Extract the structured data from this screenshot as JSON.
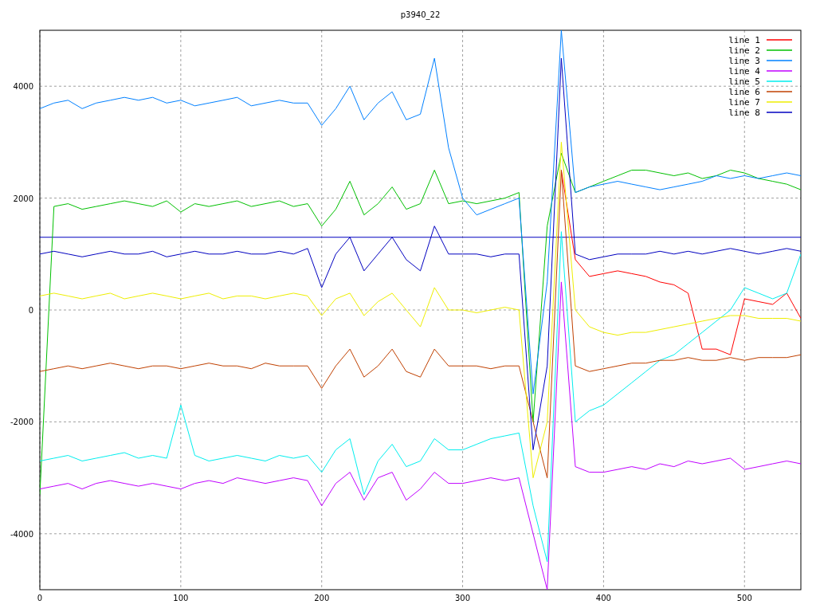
{
  "chart": {
    "chart_data": {
      "type": "line",
      "title": "p3940_22",
      "x": [
        0,
        10,
        20,
        30,
        40,
        50,
        60,
        70,
        80,
        90,
        100,
        110,
        120,
        130,
        140,
        150,
        160,
        170,
        180,
        190,
        200,
        210,
        220,
        230,
        240,
        250,
        260,
        270,
        280,
        290,
        300,
        310,
        320,
        330,
        340,
        350,
        360,
        370,
        380,
        390,
        400,
        410,
        420,
        430,
        440,
        450,
        460,
        470,
        480,
        490,
        500,
        510,
        520,
        530,
        540
      ],
      "xlim": [
        0,
        540
      ],
      "ylim": [
        -5000,
        5000
      ],
      "xticks": [
        0,
        100,
        200,
        300,
        400,
        500
      ],
      "yticks": [
        -4000,
        -2000,
        0,
        2000,
        4000
      ],
      "series": [
        {
          "name": "line 1",
          "color": "#ff0000",
          "values": [
            null,
            null,
            null,
            null,
            null,
            null,
            null,
            null,
            null,
            null,
            null,
            null,
            null,
            null,
            null,
            null,
            null,
            null,
            null,
            null,
            null,
            null,
            null,
            null,
            null,
            null,
            null,
            null,
            null,
            null,
            null,
            null,
            null,
            null,
            null,
            null,
            null,
            2500,
            900,
            600,
            650,
            700,
            650,
            600,
            500,
            450,
            300,
            -700,
            -700,
            -800,
            200,
            150,
            100,
            300,
            -150
          ]
        },
        {
          "name": "line 2",
          "color": "#00c000",
          "values": [
            -3300,
            1850,
            1900,
            1800,
            1850,
            1900,
            1950,
            1900,
            1850,
            1950,
            1750,
            1900,
            1850,
            1900,
            1950,
            1850,
            1900,
            1950,
            1850,
            1900,
            1500,
            1800,
            2300,
            1700,
            1900,
            2200,
            1800,
            1900,
            2500,
            1900,
            1950,
            1900,
            1950,
            2000,
            2100,
            -2000,
            1500,
            2800,
            2100,
            2200,
            2300,
            2400,
            2500,
            2500,
            2450,
            2400,
            2450,
            2350,
            2400,
            2500,
            2450,
            2350,
            2300,
            2250,
            2150
          ]
        },
        {
          "name": "line 3",
          "color": "#0080ff",
          "values": [
            3600,
            3700,
            3750,
            3600,
            3700,
            3750,
            3800,
            3750,
            3800,
            3700,
            3750,
            3650,
            3700,
            3750,
            3800,
            3650,
            3700,
            3750,
            3700,
            3700,
            3300,
            3600,
            4000,
            3400,
            3700,
            3900,
            3400,
            3500,
            4500,
            2900,
            2000,
            1700,
            1800,
            1900,
            2000,
            -1500,
            500,
            5000,
            2100,
            2200,
            2250,
            2300,
            2250,
            2200,
            2150,
            2200,
            2250,
            2300,
            2400,
            2350,
            2400,
            2350,
            2400,
            2450,
            2400
          ]
        },
        {
          "name": "line 4",
          "color": "#c000ff",
          "values": [
            -3200,
            -3150,
            -3100,
            -3200,
            -3100,
            -3050,
            -3100,
            -3150,
            -3100,
            -3150,
            -3200,
            -3100,
            -3050,
            -3100,
            -3000,
            -3050,
            -3100,
            -3050,
            -3000,
            -3050,
            -3500,
            -3100,
            -2900,
            -3400,
            -3000,
            -2900,
            -3400,
            -3200,
            -2900,
            -3100,
            -3100,
            -3050,
            -3000,
            -3050,
            -3000,
            -4000,
            -5000,
            500,
            -2800,
            -2900,
            -2900,
            -2850,
            -2800,
            -2850,
            -2750,
            -2800,
            -2700,
            -2750,
            -2700,
            -2650,
            -2850,
            -2800,
            -2750,
            -2700,
            -2750
          ]
        },
        {
          "name": "line 5",
          "color": "#00eeee",
          "values": [
            -2700,
            -2650,
            -2600,
            -2700,
            -2650,
            -2600,
            -2550,
            -2650,
            -2600,
            -2650,
            -1700,
            -2600,
            -2700,
            -2650,
            -2600,
            -2650,
            -2700,
            -2600,
            -2650,
            -2600,
            -2900,
            -2500,
            -2300,
            -3300,
            -2700,
            -2400,
            -2800,
            -2700,
            -2300,
            -2500,
            -2500,
            -2400,
            -2300,
            -2250,
            -2200,
            -3500,
            -4500,
            1400,
            -2000,
            -1800,
            -1700,
            -1500,
            -1300,
            -1100,
            -900,
            -800,
            -600,
            -400,
            -200,
            0,
            400,
            300,
            200,
            300,
            1000
          ]
        },
        {
          "name": "line 6",
          "color": "#c04000",
          "values": [
            -1100,
            -1050,
            -1000,
            -1050,
            -1000,
            -950,
            -1000,
            -1050,
            -1000,
            -1000,
            -1050,
            -1000,
            -950,
            -1000,
            -1000,
            -1050,
            -950,
            -1000,
            -1000,
            -1000,
            -1400,
            -1000,
            -700,
            -1200,
            -1000,
            -700,
            -1100,
            -1200,
            -700,
            -1000,
            -1000,
            -1000,
            -1050,
            -1000,
            -1000,
            -2000,
            -3000,
            2500,
            -1000,
            -1100,
            -1050,
            -1000,
            -950,
            -950,
            -900,
            -900,
            -850,
            -900,
            -900,
            -850,
            -900,
            -850,
            -850,
            -850,
            -800
          ]
        },
        {
          "name": "line 7",
          "color": "#eeee00",
          "values": [
            250,
            300,
            250,
            200,
            250,
            300,
            200,
            250,
            300,
            250,
            200,
            250,
            300,
            200,
            250,
            250,
            200,
            250,
            300,
            250,
            -100,
            200,
            300,
            -100,
            150,
            300,
            0,
            -300,
            400,
            0,
            0,
            -50,
            0,
            50,
            0,
            -3000,
            -2000,
            3000,
            0,
            -300,
            -400,
            -450,
            -400,
            -400,
            -350,
            -300,
            -250,
            -200,
            -150,
            -100,
            -100,
            -150,
            -150,
            -150,
            -200
          ]
        },
        {
          "name": "line 8",
          "color": "#0000c0",
          "values": [
            1000,
            1050,
            1000,
            950,
            1000,
            1050,
            1000,
            1000,
            1050,
            950,
            1000,
            1050,
            1000,
            1000,
            1050,
            1000,
            1000,
            1050,
            1000,
            1100,
            400,
            1000,
            1300,
            700,
            1000,
            1300,
            900,
            700,
            1500,
            1000,
            1000,
            1000,
            950,
            1000,
            1000,
            -2500,
            -1000,
            4500,
            1000,
            900,
            950,
            1000,
            1000,
            1000,
            1050,
            1000,
            1050,
            1000,
            1050,
            1100,
            1050,
            1000,
            1050,
            1100,
            1050
          ]
        }
      ],
      "ref_lines": [
        {
          "axis": "y",
          "value": 1300,
          "color": "#0000c0"
        }
      ],
      "grid": true,
      "legend": true
    }
  }
}
